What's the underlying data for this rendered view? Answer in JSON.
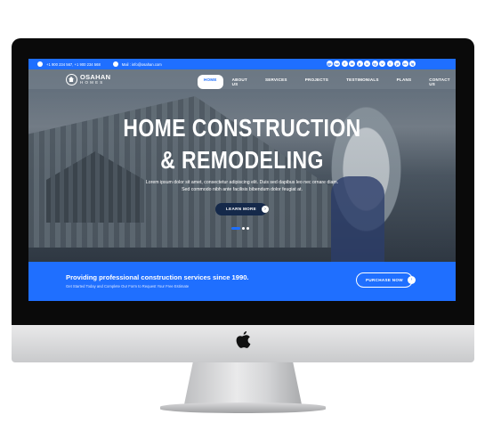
{
  "topbar": {
    "phone": "+1 900 234 567, +1 900 234 568",
    "email": "Mail : info@osahan.com",
    "socials": [
      "gp",
      "tw",
      "f",
      "in",
      "p",
      "b",
      "ig",
      "v",
      "t",
      "yt",
      "in",
      "ig"
    ]
  },
  "brand": {
    "name": "OSAHAN",
    "tag": "HOMES"
  },
  "nav": {
    "items": [
      "Home",
      "About Us",
      "Services",
      "Projects",
      "Testimonials",
      "Plans",
      "Contact Us"
    ]
  },
  "hero": {
    "title_line1": "HOME CONSTRUCTION",
    "title_line2": "& REMODELING",
    "subtitle": "Lorem ipsum dolor sit amet, consectetur adipiscing elit. Duis sed dapibus leo nec ornare diam. Sed commodo nibh ante facilisis bibendum dolor feugiat at.",
    "button": "LEARN MORE",
    "arrow": "›"
  },
  "cta": {
    "title": "Providing professional construction services since 1990.",
    "subtitle": "Get Started Today and Complete Our Form to Request Your Free Estimate",
    "button": "PURCHASE NOW",
    "arrow": "›"
  },
  "colors": {
    "accent": "#1f6fff",
    "dark": "#15294a"
  }
}
